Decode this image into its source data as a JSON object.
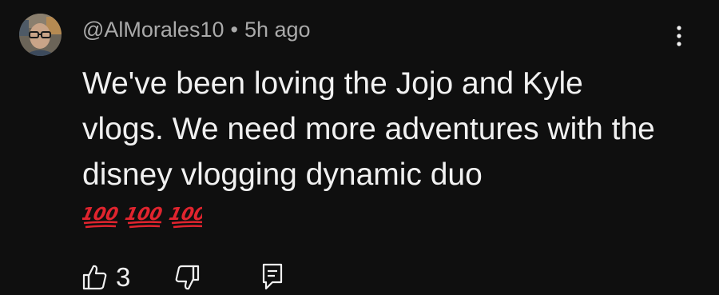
{
  "comment": {
    "author": "@AlMorales10",
    "separator": "•",
    "time": "5h ago",
    "text": "We've been loving the Jojo and Kyle vlogs. We need more adventures with the disney vlogging dynamic duo",
    "emoji_icons": [
      "hundred-points-icon",
      "hundred-points-icon",
      "hundred-points-icon"
    ],
    "like_count": "3",
    "colors": {
      "background": "#0f0f0f",
      "text": "#f1f1f1",
      "meta": "#aaaaaa",
      "emoji": "#e0242e"
    }
  }
}
